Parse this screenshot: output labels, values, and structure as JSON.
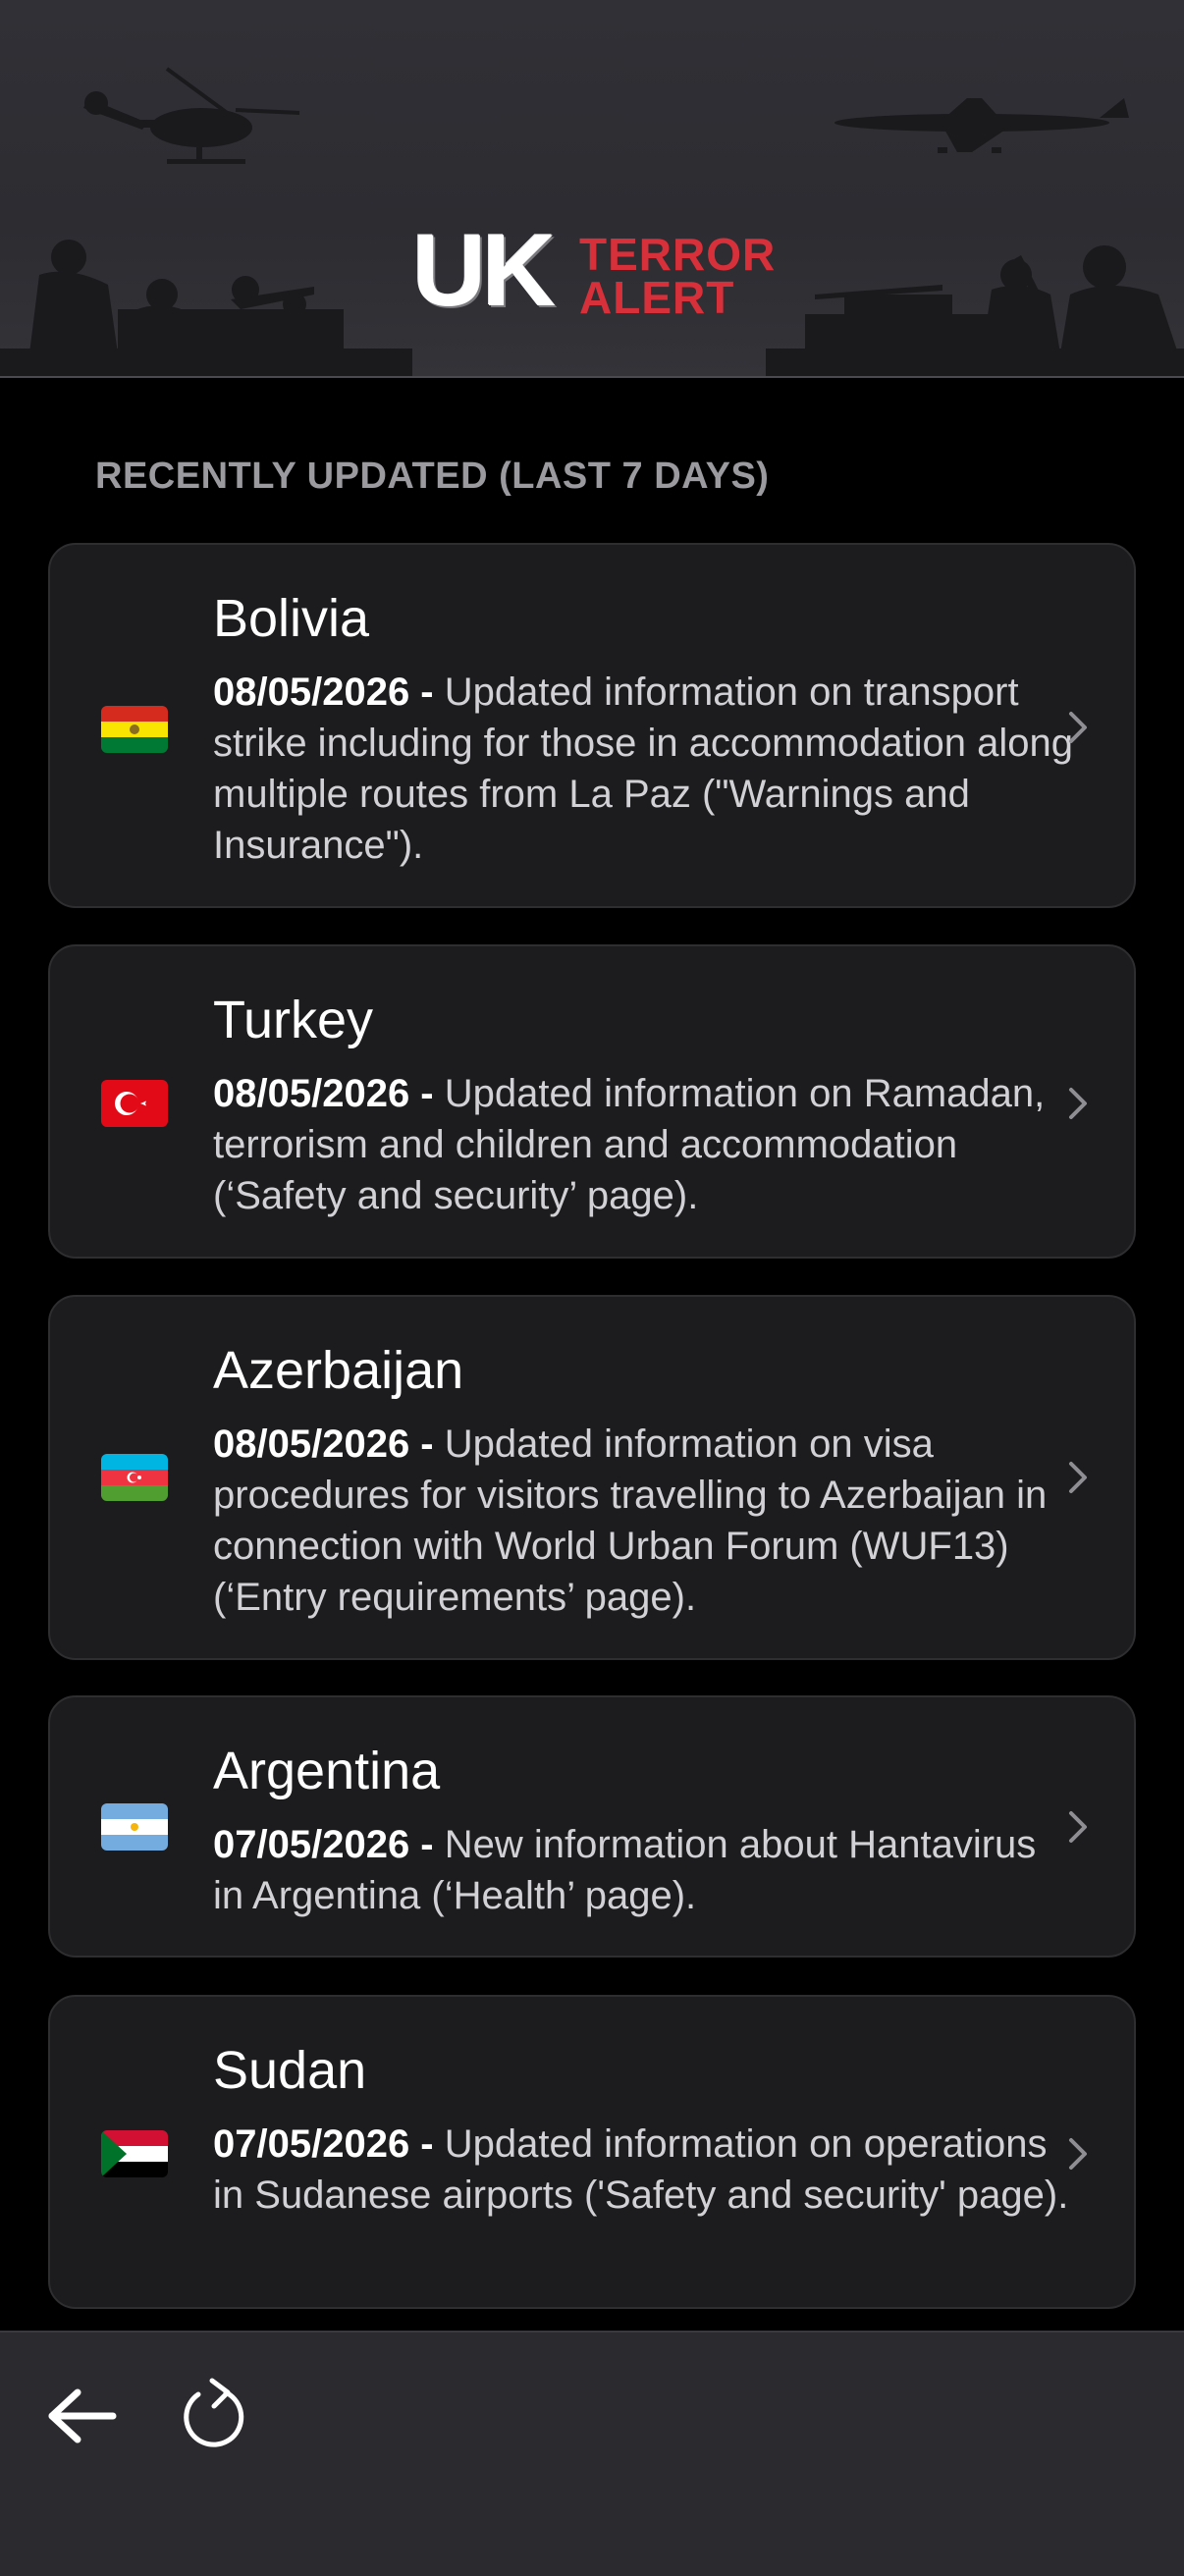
{
  "header": {
    "logo_uk": "UK",
    "logo_terror": "TERROR",
    "logo_alert": "ALERT"
  },
  "section": {
    "title": "RECENTLY UPDATED (LAST 7 DAYS)"
  },
  "cards": [
    {
      "country": "Bolivia",
      "date": "08/05/2026 -",
      "text": "Updated information on transport strike including for those in accommodation along multiple routes from La Paz (\"Warnings and Insurance\").",
      "flag": "bolivia-flag"
    },
    {
      "country": "Turkey",
      "date": "08/05/2026 -",
      "text": "Updated information on Ramadan, terrorism and children and accommodation (‘Safety and security’ page).",
      "flag": "turkey-flag"
    },
    {
      "country": "Azerbaijan",
      "date": "08/05/2026 -",
      "text": "Updated  information on visa procedures for visitors travelling to Azerbaijan in connection with World Urban Forum (WUF13) (‘Entry requirements’ page).",
      "flag": "azerbaijan-flag"
    },
    {
      "country": "Argentina",
      "date": "07/05/2026 -",
      "text": "New information about Hantavirus in Argentina (‘Health’ page).",
      "flag": "argentina-flag"
    },
    {
      "country": "Sudan",
      "date": "07/05/2026 -",
      "text": "Updated information on operations in Sudanese airports ('Safety and security' page).",
      "flag": "sudan-flag"
    }
  ],
  "toolbar": {
    "back_icon": "arrow-left-icon",
    "reload_icon": "reload-icon"
  },
  "colors": {
    "background": "#000000",
    "card": "#1c1c1e",
    "logo_red": "#d8303a",
    "bottom_bar": "#2b2b2f"
  }
}
